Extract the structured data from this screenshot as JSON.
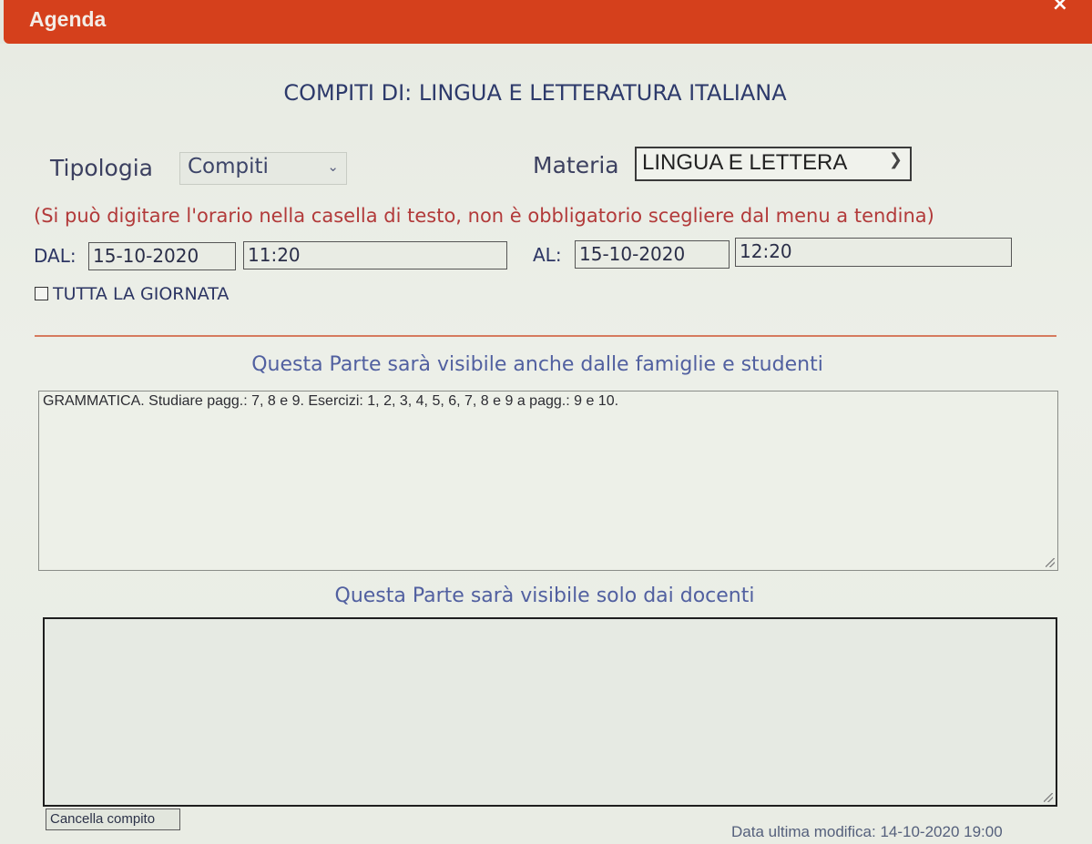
{
  "window": {
    "title": "Agenda",
    "close_glyph": "×",
    "accent_color": "#d5401c"
  },
  "heading": "COMPITI DI: LINGUA E LETTERATURA ITALIANA",
  "tipologia": {
    "label": "Tipologia",
    "selected": "Compiti"
  },
  "materia": {
    "label": "Materia",
    "selected": "LINGUA E LETTERA"
  },
  "note": "(Si può digitare l'orario nella casella di testo, non è obbligatorio scegliere dal menu a tendina)",
  "dal": {
    "label": "DAL:",
    "date": "15-10-2020",
    "time": "11:20"
  },
  "al": {
    "label": "AL:",
    "date": "15-10-2020",
    "time": "12:20"
  },
  "all_day": {
    "label": "TUTTA LA GIORNATA",
    "checked": false
  },
  "families_section": {
    "title": "Questa Parte sarà visibile anche dalle famiglie e studenti",
    "text": "GRAMMATICA. Studiare pagg.: 7, 8 e 9. Esercizi: 1, 2, 3, 4, 5, 6, 7, 8 e 9 a pagg.: 9 e 10."
  },
  "teachers_section": {
    "title": "Questa Parte sarà visibile solo dai docenti",
    "text": ""
  },
  "buttons": {
    "delete_label": "Cancella compito"
  },
  "footer": {
    "last_modified": "Data ultima modifica: 14-10-2020 19:00"
  }
}
